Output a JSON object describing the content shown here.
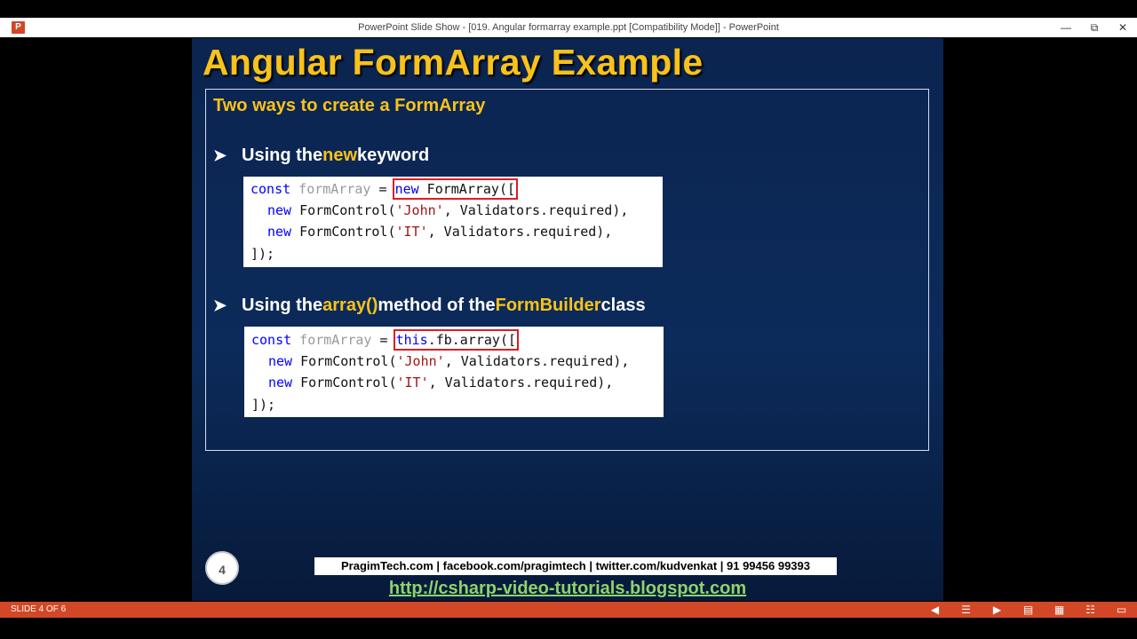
{
  "window": {
    "title": "PowerPoint Slide Show - [019. Angular formarray example.ppt [Compatibility Mode]] - PowerPoint",
    "app_icon": "P",
    "controls": [
      "minimize-icon",
      "restore-icon",
      "close-icon"
    ]
  },
  "slide": {
    "title": "Angular FormArray Example",
    "subtitle": "Two ways to create a FormArray",
    "bullet1": {
      "prefix": "Using the ",
      "highlight": "new",
      "suffix": " keyword"
    },
    "code1": {
      "line1": {
        "kw": "const",
        "var": " formArray",
        "eq": " = ",
        "boxed_kw": "new",
        "boxed_rest": " FormArray(["
      },
      "line2": {
        "kw": "new",
        "call": " FormControl(",
        "str": "'John'",
        "rest": ", Validators.required),"
      },
      "line3": {
        "kw": "new",
        "call": " FormControl(",
        "str": "'IT'",
        "rest": ", Validators.required),"
      },
      "line4": "]);"
    },
    "bullet2": {
      "prefix": "Using the ",
      "hl1": "array()",
      "mid": " method of the ",
      "hl2": "FormBuilder",
      "suffix": " class"
    },
    "code2": {
      "line1": {
        "kw": "const",
        "var": " formArray",
        "eq": " = ",
        "boxed_kw": "this",
        "boxed_rest": ".fb.array(["
      },
      "line2": {
        "kw": "new",
        "call": " FormControl(",
        "str": "'John'",
        "rest": ", Validators.required),"
      },
      "line3": {
        "kw": "new",
        "call": " FormControl(",
        "str": "'IT'",
        "rest": ", Validators.required),"
      },
      "line4": "]);"
    },
    "page_number": "4",
    "credits": "PragimTech.com | facebook.com/pragimtech | twitter.com/kudvenkat | 91 99456 99393",
    "blog_url": "http://csharp-video-tutorials.blogspot.com"
  },
  "statusbar": {
    "slide_indicator": "SLIDE 4 OF 6",
    "icons": [
      "previous-icon",
      "menu-icon",
      "next-icon",
      "normal-view-icon",
      "slide-sorter-icon",
      "reading-view-icon",
      "slide-show-icon"
    ]
  },
  "colors": {
    "title_yellow": "#f9c21a",
    "slide_blue": "#0c2b5a",
    "status_orange": "#d24726",
    "link_green": "#8ed36b",
    "highlight_red": "#e01b24"
  }
}
